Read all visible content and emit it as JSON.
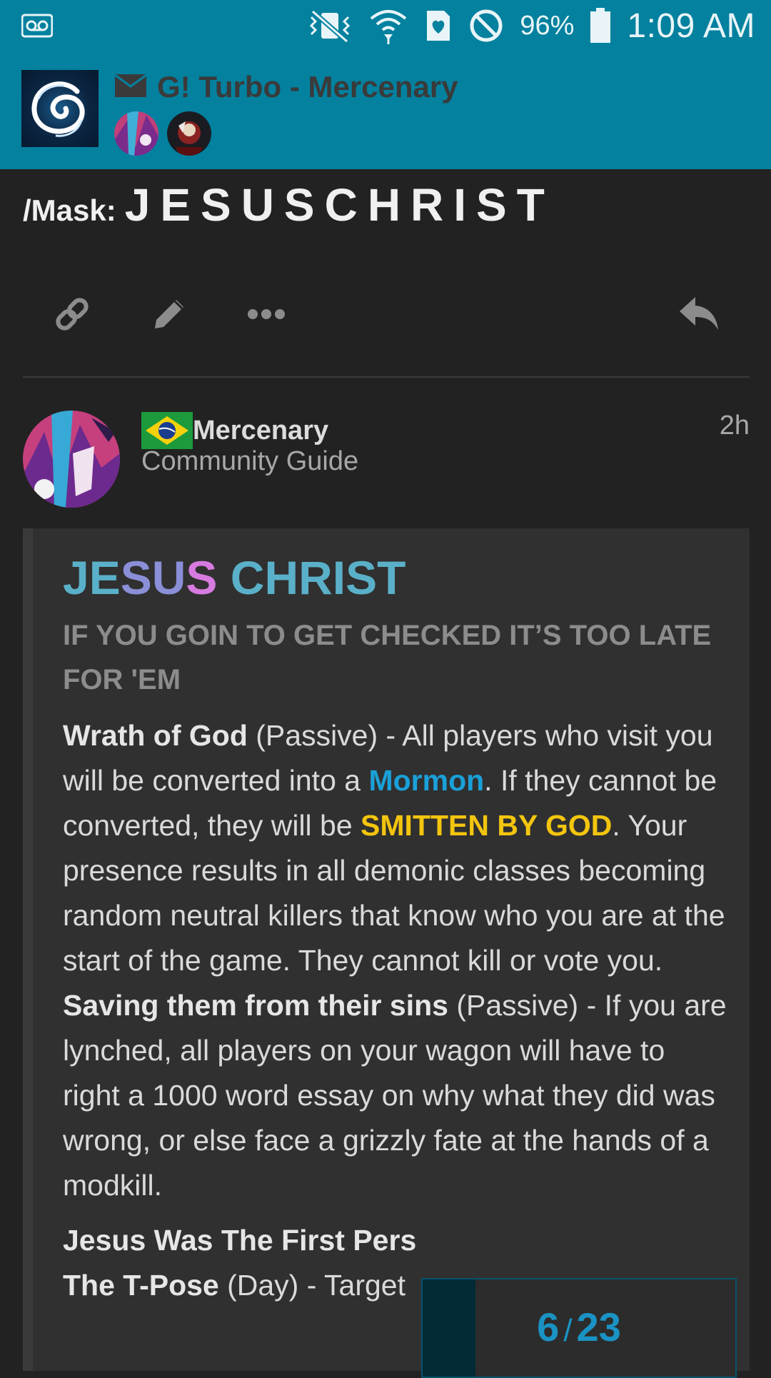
{
  "status_bar": {
    "voicemail_icon": "voicemail-icon",
    "battery_percent": "96%",
    "time": "1:09 AM"
  },
  "header": {
    "title": "G! Turbo - Mercenary",
    "message_icon": "envelope-icon"
  },
  "mask": {
    "label": "/Mask:",
    "value": "JESUSCHRIST"
  },
  "post": {
    "username": "Mercenary",
    "user_title": "Community Guide",
    "time_ago": "2h",
    "flag": "brazil-flag"
  },
  "quote": {
    "title_words": [
      {
        "text": "JE",
        "color": "#5ab0c8"
      },
      {
        "text": "SU",
        "color": "#8a8fd8"
      },
      {
        "text": "S",
        "color": "#d77be0"
      },
      {
        "text": " CHRIST",
        "color": "#5ab0c8"
      }
    ],
    "subtitle": "IF YOU GOIN TO GET CHECKED IT’S TOO LATE FOR 'EM",
    "p1_bold": "Wrath of God",
    "p1_a": " (Passive) - All players who visit you will be converted into a ",
    "p1_blue": "Mormon",
    "p1_b": ". If they cannot be converted, they will be ",
    "p1_yellow": "SMITTEN BY GOD",
    "p1_c": ". Your presence results in all demonic classes becoming random neutral killers that know who you are at the start of the game. They cannot kill or vote you.",
    "p2_bold": "Saving them from their sins",
    "p2_a": " (Passive) - If you are lynched, all players on your wagon will have to right a 1000 word essay on why what they did was wrong, or else face a grizzly fate at the hands of a modkill.",
    "p3_bold": "Jesus Was The First Pers",
    "p4_bold": "The T-Pose",
    "p4_a": " (Day) - Target"
  },
  "progress": {
    "current": "6",
    "separator": "/",
    "total": "23",
    "fraction": 0.17
  },
  "colors": {
    "accent": "#03819f",
    "background": "#222222",
    "quote_bg": "#303030",
    "link_blue": "#1aa0d8",
    "highlight_yellow": "#f3c50e"
  }
}
